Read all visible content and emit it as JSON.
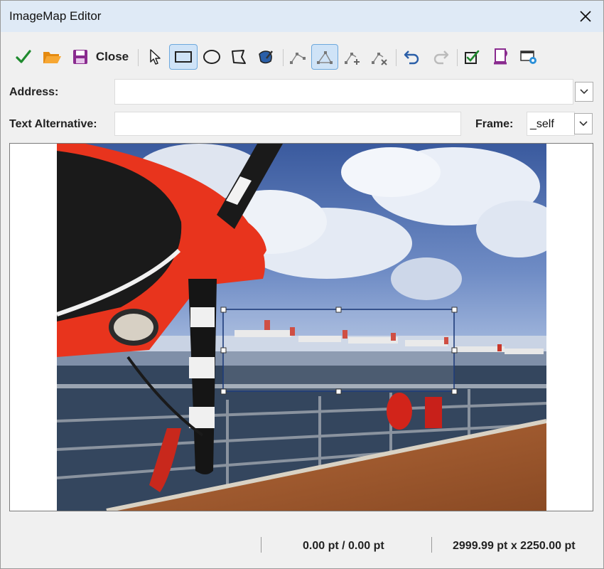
{
  "window": {
    "title": "ImageMap Editor"
  },
  "toolbar": {
    "close_label": "Close",
    "tools": [
      {
        "name": "apply-icon"
      },
      {
        "name": "open-folder-icon"
      },
      {
        "name": "save-icon"
      },
      {
        "name": "select-pointer-icon"
      },
      {
        "name": "rectangle-icon",
        "selected": true
      },
      {
        "name": "ellipse-icon"
      },
      {
        "name": "polygon-icon"
      },
      {
        "name": "freeform-polygon-icon"
      },
      {
        "name": "move-points-icon"
      },
      {
        "name": "edit-points-icon",
        "selected": true
      },
      {
        "name": "insert-points-icon"
      },
      {
        "name": "delete-points-icon"
      },
      {
        "name": "undo-icon"
      },
      {
        "name": "redo-icon"
      },
      {
        "name": "active-checkbox-icon"
      },
      {
        "name": "macro-icon"
      },
      {
        "name": "properties-icon"
      }
    ]
  },
  "form": {
    "address_label": "Address:",
    "address_value": "",
    "text_alt_label": "Text Alternative:",
    "text_alt_value": "",
    "frame_label": "Frame:",
    "frame_value": "_self"
  },
  "status": {
    "position": "0.00 pt / 0.00 pt",
    "size": "2999.99 pt x 2250.00 pt"
  },
  "colors": {
    "accent": "#2b5fa8",
    "selection_outline": "#1f3c7a"
  }
}
